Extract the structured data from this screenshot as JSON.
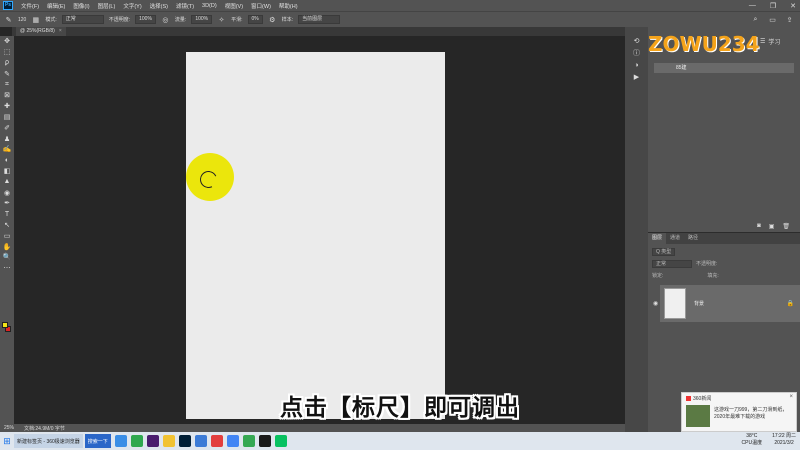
{
  "menu": {
    "logo": "Ps",
    "items": [
      "文件(F)",
      "编辑(E)",
      "图像(I)",
      "图层(L)",
      "文字(Y)",
      "选择(S)",
      "滤镜(T)",
      "3D(D)",
      "视图(V)",
      "窗口(W)",
      "帮助(H)"
    ],
    "window_controls": [
      "—",
      "❐",
      "✕"
    ]
  },
  "options": {
    "brush_size": "120",
    "mode_label": "模式:",
    "mode_value": "正常",
    "opacity_label": "不透明度:",
    "opacity_value": "100%",
    "flow_label": "流量:",
    "flow_value": "100%",
    "smoothing_label": "平滑:",
    "smoothing_value": "0%",
    "sample_label": "样本:",
    "sample_value": "当前图层"
  },
  "document_tab": {
    "label": "@ 25%(RGB/8)",
    "close": "×"
  },
  "toolbar": {
    "icons": [
      "✥",
      "⬚",
      "ϼ",
      "✎",
      "⌗",
      "⊠",
      "✚",
      "▤",
      "✐",
      "♟",
      "✍",
      "◐",
      "◧",
      "▲",
      "◉",
      "✒",
      "T",
      "↖",
      "▭",
      "✋",
      "🔍",
      "⋯"
    ]
  },
  "colors": {
    "foreground": "#f2e318",
    "background": "#e02020",
    "highlight": "#ebe60c",
    "canvas_bg": "#ebebeb"
  },
  "subtitle": "点击【标尺】即可调出",
  "status": {
    "zoom": "25%",
    "doc_info": "文档:24.9M/0 字节"
  },
  "right_panel": {
    "learn": "学习",
    "history_item": "85建",
    "watermark": "ZOWU234"
  },
  "layers_panel": {
    "tabs": [
      "图层",
      "通道",
      "路径"
    ],
    "kind_label": "Q 类型",
    "blend_mode": "正常",
    "opacity_label": "不透明度:",
    "lock_label": "锁定:",
    "fill_label": "填充:",
    "layer_name": "背景"
  },
  "notification": {
    "app": "360新闻",
    "message": "这游戏一刀999，第二刀滑到纸，2020年最难下载的游戏"
  },
  "taskbar": {
    "tasks": [
      "新建标签页 - 360极速浏览器",
      "搜索一下"
    ],
    "temperature": "38°C",
    "temp_label": "CPU温度",
    "time": "17:22 周二",
    "date": "2021/3/2"
  }
}
